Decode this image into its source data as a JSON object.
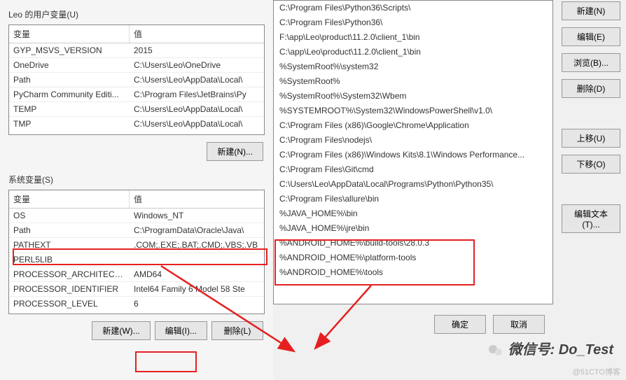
{
  "userVars": {
    "sectionLabel": "Leo 的用户变量(U)",
    "headers": {
      "name": "变量",
      "value": "值"
    },
    "rows": [
      {
        "name": "GYP_MSVS_VERSION",
        "value": "2015"
      },
      {
        "name": "OneDrive",
        "value": "C:\\Users\\Leo\\OneDrive"
      },
      {
        "name": "Path",
        "value": "C:\\Users\\Leo\\AppData\\Local\\"
      },
      {
        "name": "PyCharm Community Editi...",
        "value": "C:\\Program Files\\JetBrains\\Py"
      },
      {
        "name": "TEMP",
        "value": "C:\\Users\\Leo\\AppData\\Local\\"
      },
      {
        "name": "TMP",
        "value": "C:\\Users\\Leo\\AppData\\Local\\"
      }
    ],
    "buttons": {
      "new": "新建(N)..."
    }
  },
  "sysVars": {
    "sectionLabel": "系统变量(S)",
    "headers": {
      "name": "变量",
      "value": "值"
    },
    "rows": [
      {
        "name": "OS",
        "value": "Windows_NT"
      },
      {
        "name": "Path",
        "value": "C:\\ProgramData\\Oracle\\Java\\"
      },
      {
        "name": "PATHEXT",
        "value": ".COM;.EXE;.BAT;.CMD;.VBS;.VB"
      },
      {
        "name": "PERL5LIB",
        "value": ""
      },
      {
        "name": "PROCESSOR_ARCHITECT...",
        "value": "AMD64"
      },
      {
        "name": "PROCESSOR_IDENTIFIER",
        "value": "Intel64 Family 6 Model 58 Ste"
      },
      {
        "name": "PROCESSOR_LEVEL",
        "value": "6"
      }
    ],
    "buttons": {
      "new": "新建(W)...",
      "edit": "编辑(I)...",
      "delete": "删除(L)"
    }
  },
  "pathList": [
    "C:\\Program Files\\Python36\\Scripts\\",
    "C:\\Program Files\\Python36\\",
    "F:\\app\\Leo\\product\\11.2.0\\client_1\\bin",
    "C:\\app\\Leo\\product\\11.2.0\\client_1\\bin",
    "%SystemRoot%\\system32",
    "%SystemRoot%",
    "%SystemRoot%\\System32\\Wbem",
    "%SYSTEMROOT%\\System32\\WindowsPowerShell\\v1.0\\",
    "C:\\Program Files (x86)\\Google\\Chrome\\Application",
    "C:\\Program Files\\nodejs\\",
    "C:\\Program Files (x86)\\Windows Kits\\8.1\\Windows Performance...",
    "C:\\Program Files\\Git\\cmd",
    "C:\\Users\\Leo\\AppData\\Local\\Programs\\Python\\Python35\\",
    "C:\\Program Files\\allure\\bin",
    "%JAVA_HOME%\\bin",
    "%JAVA_HOME%\\jre\\bin",
    "%ANDROID_HOME%\\build-tools\\28.0.3",
    "%ANDROID_HOME%\\platform-tools",
    "%ANDROID_HOME%\\tools"
  ],
  "rightButtons": {
    "new": "新建(N)",
    "edit": "编辑(E)",
    "browse": "浏览(B)...",
    "delete": "删除(D)",
    "moveUp": "上移(U)",
    "moveDown": "下移(O)",
    "editText": "编辑文本(T)..."
  },
  "dialogButtons": {
    "ok": "确定",
    "cancel": "取消"
  },
  "wechatLabel": "微信号: Do_Test",
  "watermark": "@51CTO博客"
}
